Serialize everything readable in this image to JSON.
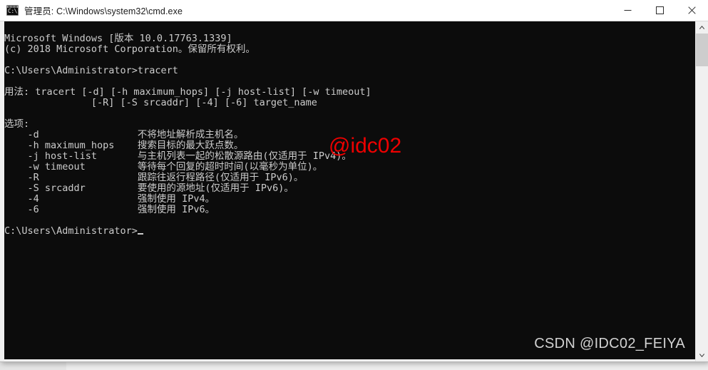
{
  "window": {
    "title": "管理员: C:\\Windows\\system32\\cmd.exe",
    "icon": "cmd-console-icon",
    "icon_glyph": "C:\\.",
    "controls": {
      "minimize_label": "最小化",
      "maximize_label": "最大化",
      "close_label": "关闭"
    },
    "colors": {
      "background": "#0c0c0c",
      "foreground": "#cccccc",
      "titlebar": "#ffffff",
      "accent_red": "#ee0000",
      "watermark_gray": "#d2d2d2"
    }
  },
  "console": {
    "lines": [
      "Microsoft Windows [版本 10.0.17763.1339]",
      "(c) 2018 Microsoft Corporation。保留所有权利。",
      "",
      "C:\\Users\\Administrator>tracert",
      "",
      "用法: tracert [-d] [-h maximum_hops] [-j host-list] [-w timeout]",
      "               [-R] [-S srcaddr] [-4] [-6] target_name",
      "",
      "选项:",
      "    -d                 不将地址解析成主机名。",
      "    -h maximum_hops    搜索目标的最大跃点数。",
      "    -j host-list       与主机列表一起的松散源路由(仅适用于 IPv4)。",
      "    -w timeout         等待每个回复的超时时间(以毫秒为单位)。",
      "    -R                 跟踪往返行程路径(仅适用于 IPv6)。",
      "    -S srcaddr         要使用的源地址(仅适用于 IPv6)。",
      "    -4                 强制使用 IPv4。",
      "    -6                 强制使用 IPv6。",
      ""
    ],
    "prompt": "C:\\Users\\Administrator>",
    "command_typed": ""
  },
  "watermarks": {
    "red": "@idc02",
    "csdn": "CSDN @IDC02_FEIYA"
  },
  "scrollbar": {
    "up_arrow": "▲",
    "down_arrow": "▼",
    "thumb_position_pct": 0
  }
}
